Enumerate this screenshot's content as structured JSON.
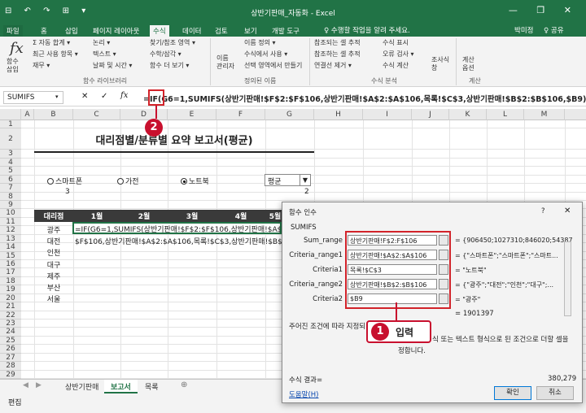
{
  "window": {
    "title": "상반기판매_자동화 - Excel",
    "qat": "⊟ ↶ ↷ ⊞ ▾",
    "controls": "— ❐ ✕"
  },
  "tabs": [
    "파일",
    "홈",
    "삽입",
    "페이지 레이아웃",
    "수식",
    "데이터",
    "검토",
    "보기",
    "개발 도구"
  ],
  "tell_me": "♀ 수행할 작업을 알려 주세요.",
  "user": "박미정",
  "share": "♀ 공유",
  "ribbon": {
    "insert_function": "함수\n삽입",
    "fx": "fx",
    "group1": [
      "Σ 자동 합계 ▾",
      "최근 사용 항목 ▾",
      "재무 ▾"
    ],
    "group2": [
      "논리 ▾",
      "텍스트 ▾",
      "날짜 및 시간 ▾"
    ],
    "group3": [
      "찾기/참조 영역 ▾",
      "수학/삼각 ▾",
      "함수 더 보기 ▾"
    ],
    "group_label1": "함수 라이브러리",
    "name_manager": "이름\n관리자",
    "names": [
      "이름 정의 ▾",
      "수식에서 사용 ▾",
      "선택 영역에서 만들기"
    ],
    "group_label2": "정의된 이름",
    "audit1": [
      "참조되는 셀 추적",
      "참조하는 셀 추적",
      "연결선 제거 ▾"
    ],
    "audit2": [
      "수식 표시",
      "오류 검사 ▾",
      "수식 계산"
    ],
    "watch": "조사식\n창",
    "group_label3": "수식 분석",
    "calc_options": "계산\n옵션",
    "group_label4": "계산"
  },
  "formula_bar": {
    "name_box": "SUMIFS",
    "formula": "=IF(G6=1,SUMIFS(상반기판매!$F$2:$F$106,상반기판매!$A$2:$A$106,목록!$C$3,상반기판매!$B$2:$B$106,$B9),"
  },
  "columns": [
    "A",
    "B",
    "C",
    "D",
    "E",
    "F",
    "G",
    "H",
    "I",
    "J",
    "K",
    "L",
    "M"
  ],
  "rows": [
    "1",
    "2",
    "3",
    "4",
    "5",
    "6",
    "7",
    "8",
    "9",
    "10",
    "11",
    "12",
    "13",
    "14",
    "15",
    "16",
    "17",
    "18",
    "19",
    "20",
    "21",
    "22",
    "23",
    "24",
    "25",
    "26",
    "27",
    "28",
    "29"
  ],
  "sheet": {
    "title": "대리점별/분류별 요약 보고서(평균)",
    "radios": [
      "스마트폰",
      "가전",
      "노트북"
    ],
    "b6": "3",
    "dropdown": "평균",
    "g6": "2",
    "header": [
      "대리점",
      "1월",
      "2월",
      "3월",
      "4월",
      "5월"
    ],
    "branches": [
      "광주",
      "대전",
      "인천",
      "대구",
      "제주",
      "부산",
      "서울"
    ],
    "c9": "=IF(G6=1,SUMIFS(상반기판매!$F$2:$F$106,상반기판매!$A$2:$A$",
    "b10_overflow": "$F$106,상반기판매!$A$2:$A$106,목록!$C$3,상반기판매!$B$2:"
  },
  "sheet_tabs": [
    "상반기판매",
    "보고서",
    "목록"
  ],
  "status": "편집",
  "dialog": {
    "title": "함수 인수",
    "help": "?",
    "function": "SUMIFS",
    "args": [
      {
        "label": "Sum_range",
        "value": "상반기판매!F$2:F$106",
        "result": "= {906450;1027310;846020;54387"
      },
      {
        "label": "Criteria_range1",
        "value": "상반기판매!$A$2:$A$106",
        "result": "= {\"스마트폰\";\"스마트폰\";\"스마트..."
      },
      {
        "label": "Criteria1",
        "value": "목록!$C$3",
        "result": "= \"노트북\""
      },
      {
        "label": "Criteria_range2",
        "value": "상반기판매!$B$2:$B$106",
        "result": "= {\"광주\";\"대전\";\"인천\";\"대구\";..."
      },
      {
        "label": "Criteria2",
        "value": "$B9",
        "result": "= \"광주\""
      }
    ],
    "total": "= 1901397",
    "desc": "주어진 조건에 따라 지정되",
    "desc2": "식 또는 텍스트 형식으로 된 조건으로 더할 셀을",
    "desc3": "정합니다.",
    "result_label": "수식 결과=",
    "result_value": "380,279",
    "help_link": "도움말(H)",
    "ok": "확인",
    "cancel": "취소"
  },
  "annotations": {
    "badge1": "1",
    "badge1_label": "입력",
    "badge2": "2",
    "accent": "#c8102e"
  }
}
